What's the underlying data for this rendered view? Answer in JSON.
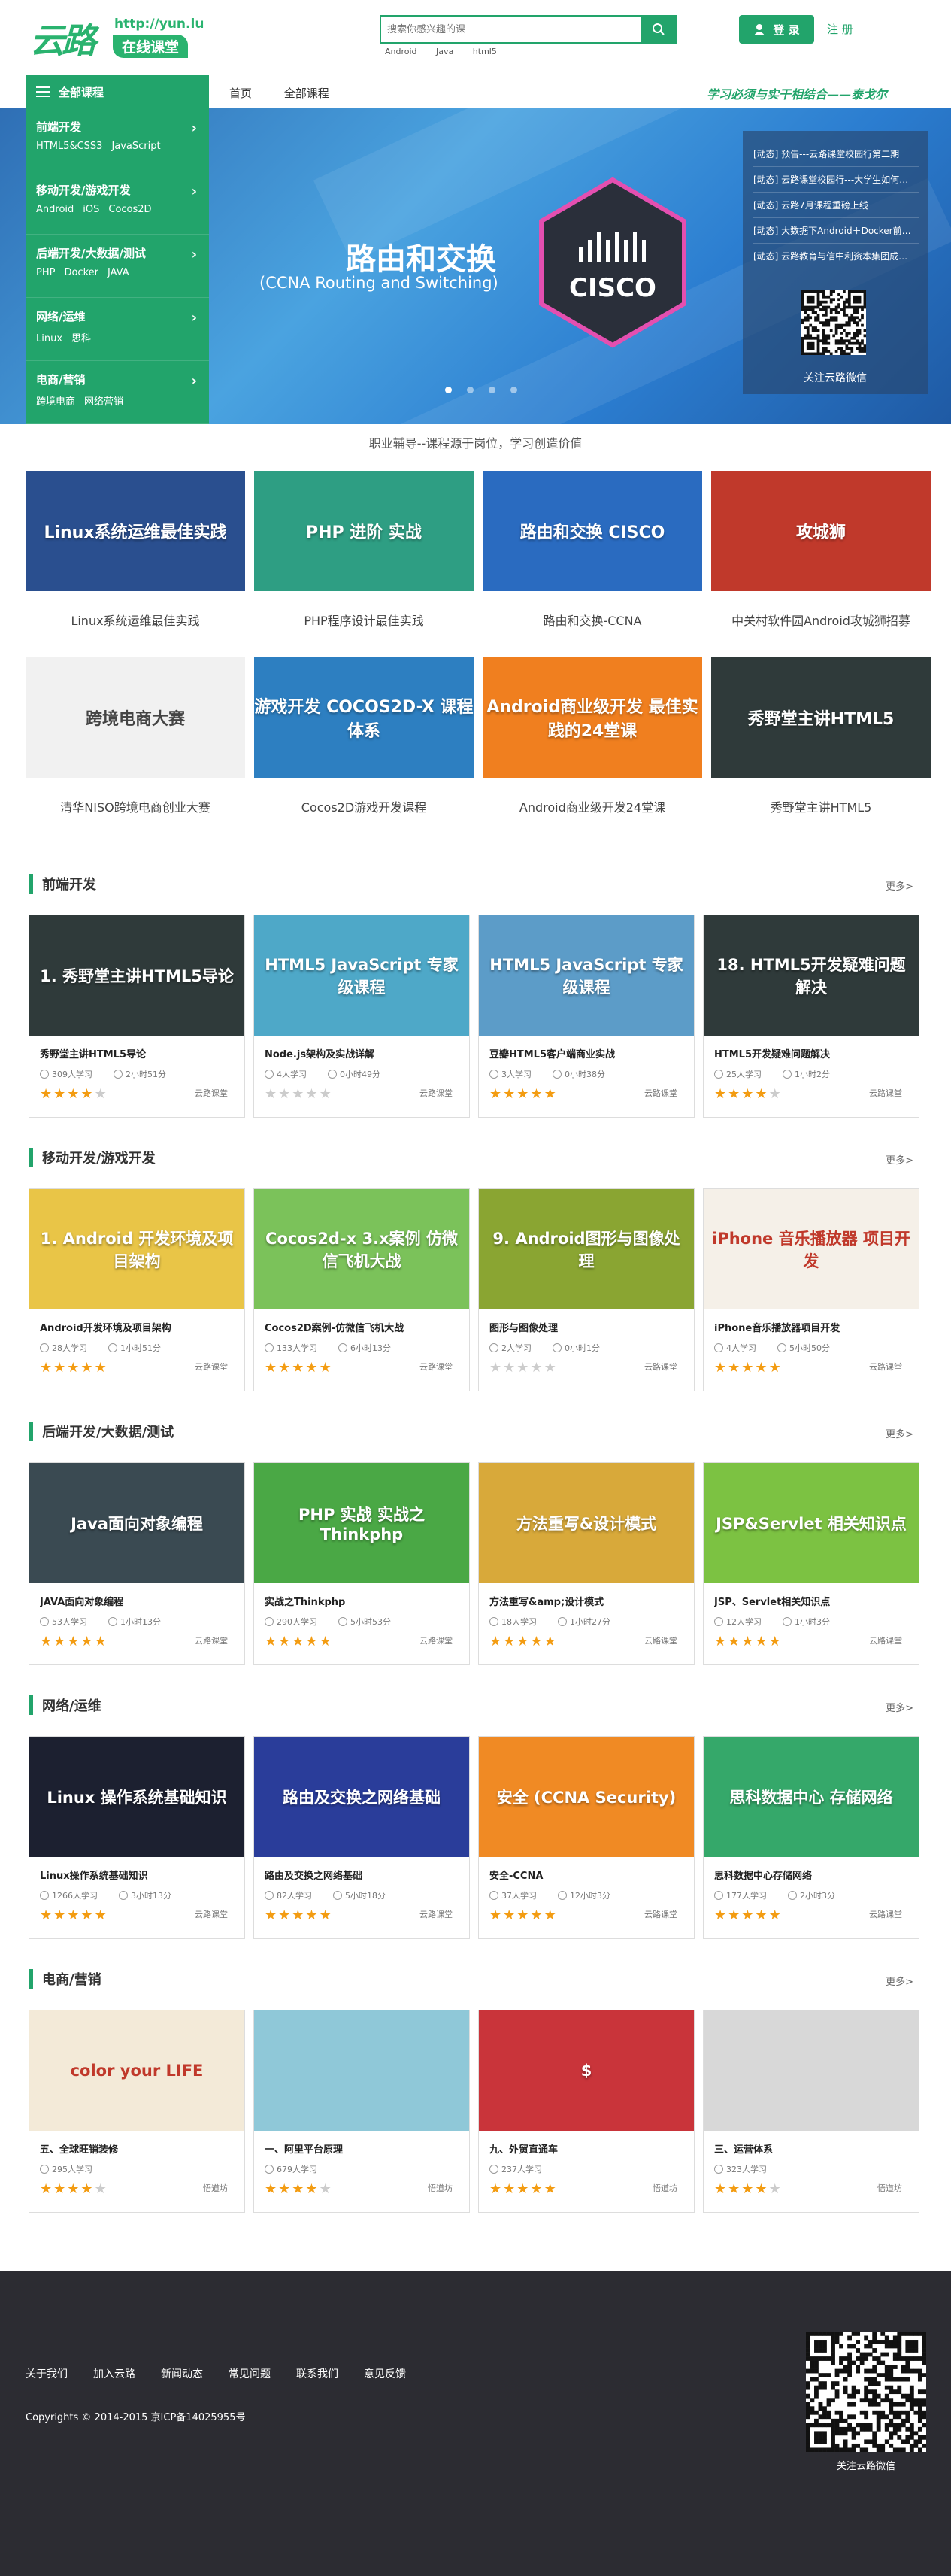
{
  "logo": {
    "big": "云路",
    "url": "http://yun.lu",
    "tagline": "在线课堂"
  },
  "search": {
    "placeholder": "搜索你感兴趣的课",
    "hot": [
      "Android",
      "Java",
      "html5"
    ]
  },
  "header": {
    "login": "登 录",
    "register": "注 册"
  },
  "nav": {
    "all_courses_label": "全部课程",
    "links": [
      "首页",
      "全部课程"
    ],
    "slogan": "学习必须与实干相结合——泰戈尔"
  },
  "categories": [
    {
      "title": "前端开发",
      "subs": [
        "HTML5&CSS3",
        "JavaScript"
      ]
    },
    {
      "title": "移动开发/游戏开发",
      "subs": [
        "Android",
        "iOS",
        "Cocos2D"
      ]
    },
    {
      "title": "后端开发/大数据/测试",
      "subs": [
        "PHP",
        "Docker",
        "JAVA"
      ]
    },
    {
      "title": "网络/运维",
      "subs": [
        "Linux",
        "思科"
      ]
    },
    {
      "title": "电商/营销",
      "subs": [
        "跨境电商",
        "网络营销"
      ]
    }
  ],
  "banner": {
    "title": "路由和交换",
    "subtitle": "(CCNA Routing and Switching)",
    "logo_text": "CISCO",
    "news": [
      "[动态]  预告---云路课堂校园行第二期",
      "[动态]  云路课堂校园行---大学生如何…",
      "[动态]  云路7月课程重磅上线",
      "[动态]  大数据下Android＋Docker前…",
      "[动态]  云路教育与信中利资本集团成…"
    ],
    "qr_label": "关注云路微信"
  },
  "motto": "职业辅导--课程源于岗位，学习创造价值",
  "featured": [
    {
      "caption": "Linux系统运维最佳实践",
      "img_text": "Linux系统运维最佳实践",
      "bg": "#2a4f8f"
    },
    {
      "caption": "PHP程序设计最佳实践",
      "img_text": "PHP 进阶 实战",
      "bg": "#2e9e83"
    },
    {
      "caption": "路由和交换-CCNA",
      "img_text": "路由和交换 CISCO",
      "bg": "#2a6bc0"
    },
    {
      "caption": "中关村软件园Android攻城狮招募",
      "img_text": "攻城狮",
      "bg": "#c0392b"
    },
    {
      "caption": "清华NISO跨境电商创业大赛",
      "img_text": "跨境电商大赛",
      "bg": "#f1f1f1"
    },
    {
      "caption": "Cocos2D游戏开发课程",
      "img_text": "游戏开发 COCOS2D-X 课程体系",
      "bg": "#2d7fc1"
    },
    {
      "caption": "Android商业级开发24堂课",
      "img_text": "Android商业级开发 最佳实践的24堂课",
      "bg": "#f07f1f"
    },
    {
      "caption": "秀野堂主讲HTML5",
      "img_text": "秀野堂主讲HTML5",
      "bg": "#2f3a3a"
    }
  ],
  "sections": [
    {
      "title": "前端开发",
      "more": "更多>",
      "courses": [
        {
          "name": "秀野堂主讲HTML5导论",
          "students": "309人学习",
          "time": "2小时51分",
          "stars": 4,
          "source": "云路课堂",
          "img_text": "1. 秀野堂主讲HTML5导论",
          "bg": "#2f3a3a"
        },
        {
          "name": "Node.js架构及实战详解",
          "students": "4人学习",
          "time": "0小时49分",
          "stars": 0,
          "source": "云路课堂",
          "img_text": "HTML5 JavaScript 专家级课程",
          "bg": "#4ea8c8"
        },
        {
          "name": "豆瓣HTML5客户端商业实战",
          "students": "3人学习",
          "time": "0小时38分",
          "stars": 5,
          "source": "云路课堂",
          "img_text": "HTML5 JavaScript 专家级课程",
          "bg": "#5c9cc8"
        },
        {
          "name": "HTML5开发疑难问题解决",
          "students": "25人学习",
          "time": "1小时2分",
          "stars": 4,
          "source": "云路课堂",
          "img_text": "18. HTML5开发疑难问题解决",
          "bg": "#2f3a3a"
        }
      ]
    },
    {
      "title": "移动开发/游戏开发",
      "more": "更多>",
      "courses": [
        {
          "name": "Android开发环境及项目架构",
          "students": "28人学习",
          "time": "1小时51分",
          "stars": 5,
          "source": "云路课堂",
          "img_text": "1. Android 开发环境及项目架构",
          "bg": "#e9c547"
        },
        {
          "name": "Cocos2D案例-仿微信飞机大战",
          "students": "133人学习",
          "time": "6小时13分",
          "stars": 5,
          "source": "云路课堂",
          "img_text": "Cocos2d-x 3.x案例 仿微信飞机大战",
          "bg": "#7bc25a"
        },
        {
          "name": "图形与图像处理",
          "students": "2人学习",
          "time": "0小时1分",
          "stars": 0,
          "source": "云路课堂",
          "img_text": "9. Android图形与图像处理",
          "bg": "#8aa532"
        },
        {
          "name": "iPhone音乐播放器项目开发",
          "students": "4人学习",
          "time": "5小时50分",
          "stars": 5,
          "source": "云路课堂",
          "img_text": "iPhone 音乐播放器 项目开发",
          "bg": "#f5f0e8"
        }
      ]
    },
    {
      "title": "后端开发/大数据/测试",
      "more": "更多>",
      "courses": [
        {
          "name": "JAVA面向对象编程",
          "students": "53人学习",
          "time": "1小时13分",
          "stars": 5,
          "source": "云路课堂",
          "img_text": "Java面向对象编程",
          "bg": "#3a4a52"
        },
        {
          "name": "实战之Thinkphp",
          "students": "290人学习",
          "time": "5小时53分",
          "stars": 5,
          "source": "云路课堂",
          "img_text": "PHP 实战 实战之Thinkphp",
          "bg": "#4aa845"
        },
        {
          "name": "方法重写&amp;设计模式",
          "students": "18人学习",
          "time": "1小时27分",
          "stars": 5,
          "source": "云路课堂",
          "img_text": "方法重写&设计模式",
          "bg": "#d8a93a"
        },
        {
          "name": "JSP、Servlet相关知识点",
          "students": "12人学习",
          "time": "1小时3分",
          "stars": 5,
          "source": "云路课堂",
          "img_text": "JSP&Servlet 相关知识点",
          "bg": "#7cc242"
        }
      ]
    },
    {
      "title": "网络/运维",
      "more": "更多>",
      "courses": [
        {
          "name": "Linux操作系统基础知识",
          "students": "1266人学习",
          "time": "3小时13分",
          "stars": 5,
          "source": "云路课堂",
          "img_text": "Linux 操作系统基础知识",
          "bg": "#1c2030"
        },
        {
          "name": "路由及交换之网络基础",
          "students": "82人学习",
          "time": "5小时18分",
          "stars": 5,
          "source": "云路课堂",
          "img_text": "路由及交换之网络基础",
          "bg": "#2a3d9a"
        },
        {
          "name": "安全-CCNA",
          "students": "37人学习",
          "time": "12小时3分",
          "stars": 5,
          "source": "云路课堂",
          "img_text": "安全 (CCNA Security)",
          "bg": "#f08a24"
        },
        {
          "name": "思科数据中心存储网络",
          "students": "177人学习",
          "time": "2小时3分",
          "stars": 5,
          "source": "云路课堂",
          "img_text": "思科数据中心 存储网络",
          "bg": "#35a86a"
        }
      ]
    },
    {
      "title": "电商/营销",
      "more": "更多>",
      "courses": [
        {
          "name": "五、全球旺销装修",
          "students": "295人学习",
          "time": "",
          "stars": 4,
          "source": "悟道坊",
          "img_text": "color your LIFE",
          "bg": "#f3ead8"
        },
        {
          "name": "一、阿里平台原理",
          "students": "679人学习",
          "time": "",
          "stars": 4,
          "source": "悟道坊",
          "img_text": "",
          "bg": "#8fc8d8"
        },
        {
          "name": "九、外贸直通车",
          "students": "237人学习",
          "time": "",
          "stars": 5,
          "source": "悟道坊",
          "img_text": "$",
          "bg": "#c9343a"
        },
        {
          "name": "三、运营体系",
          "students": "323人学习",
          "time": "",
          "stars": 4,
          "source": "悟道坊",
          "img_text": "",
          "bg": "#d8d8d8"
        }
      ]
    }
  ],
  "footer": {
    "links": [
      "关于我们",
      "加入云路",
      "新闻动态",
      "常见问题",
      "联系我们",
      "意见反馈"
    ],
    "copyright": "Copyrights © 2014-2015   京ICP备14025955号",
    "qr_label": "关注云路微信"
  },
  "colors": {
    "accent": "#22a46b",
    "star": "#f39c12",
    "footer_bg": "#2c2c32"
  }
}
